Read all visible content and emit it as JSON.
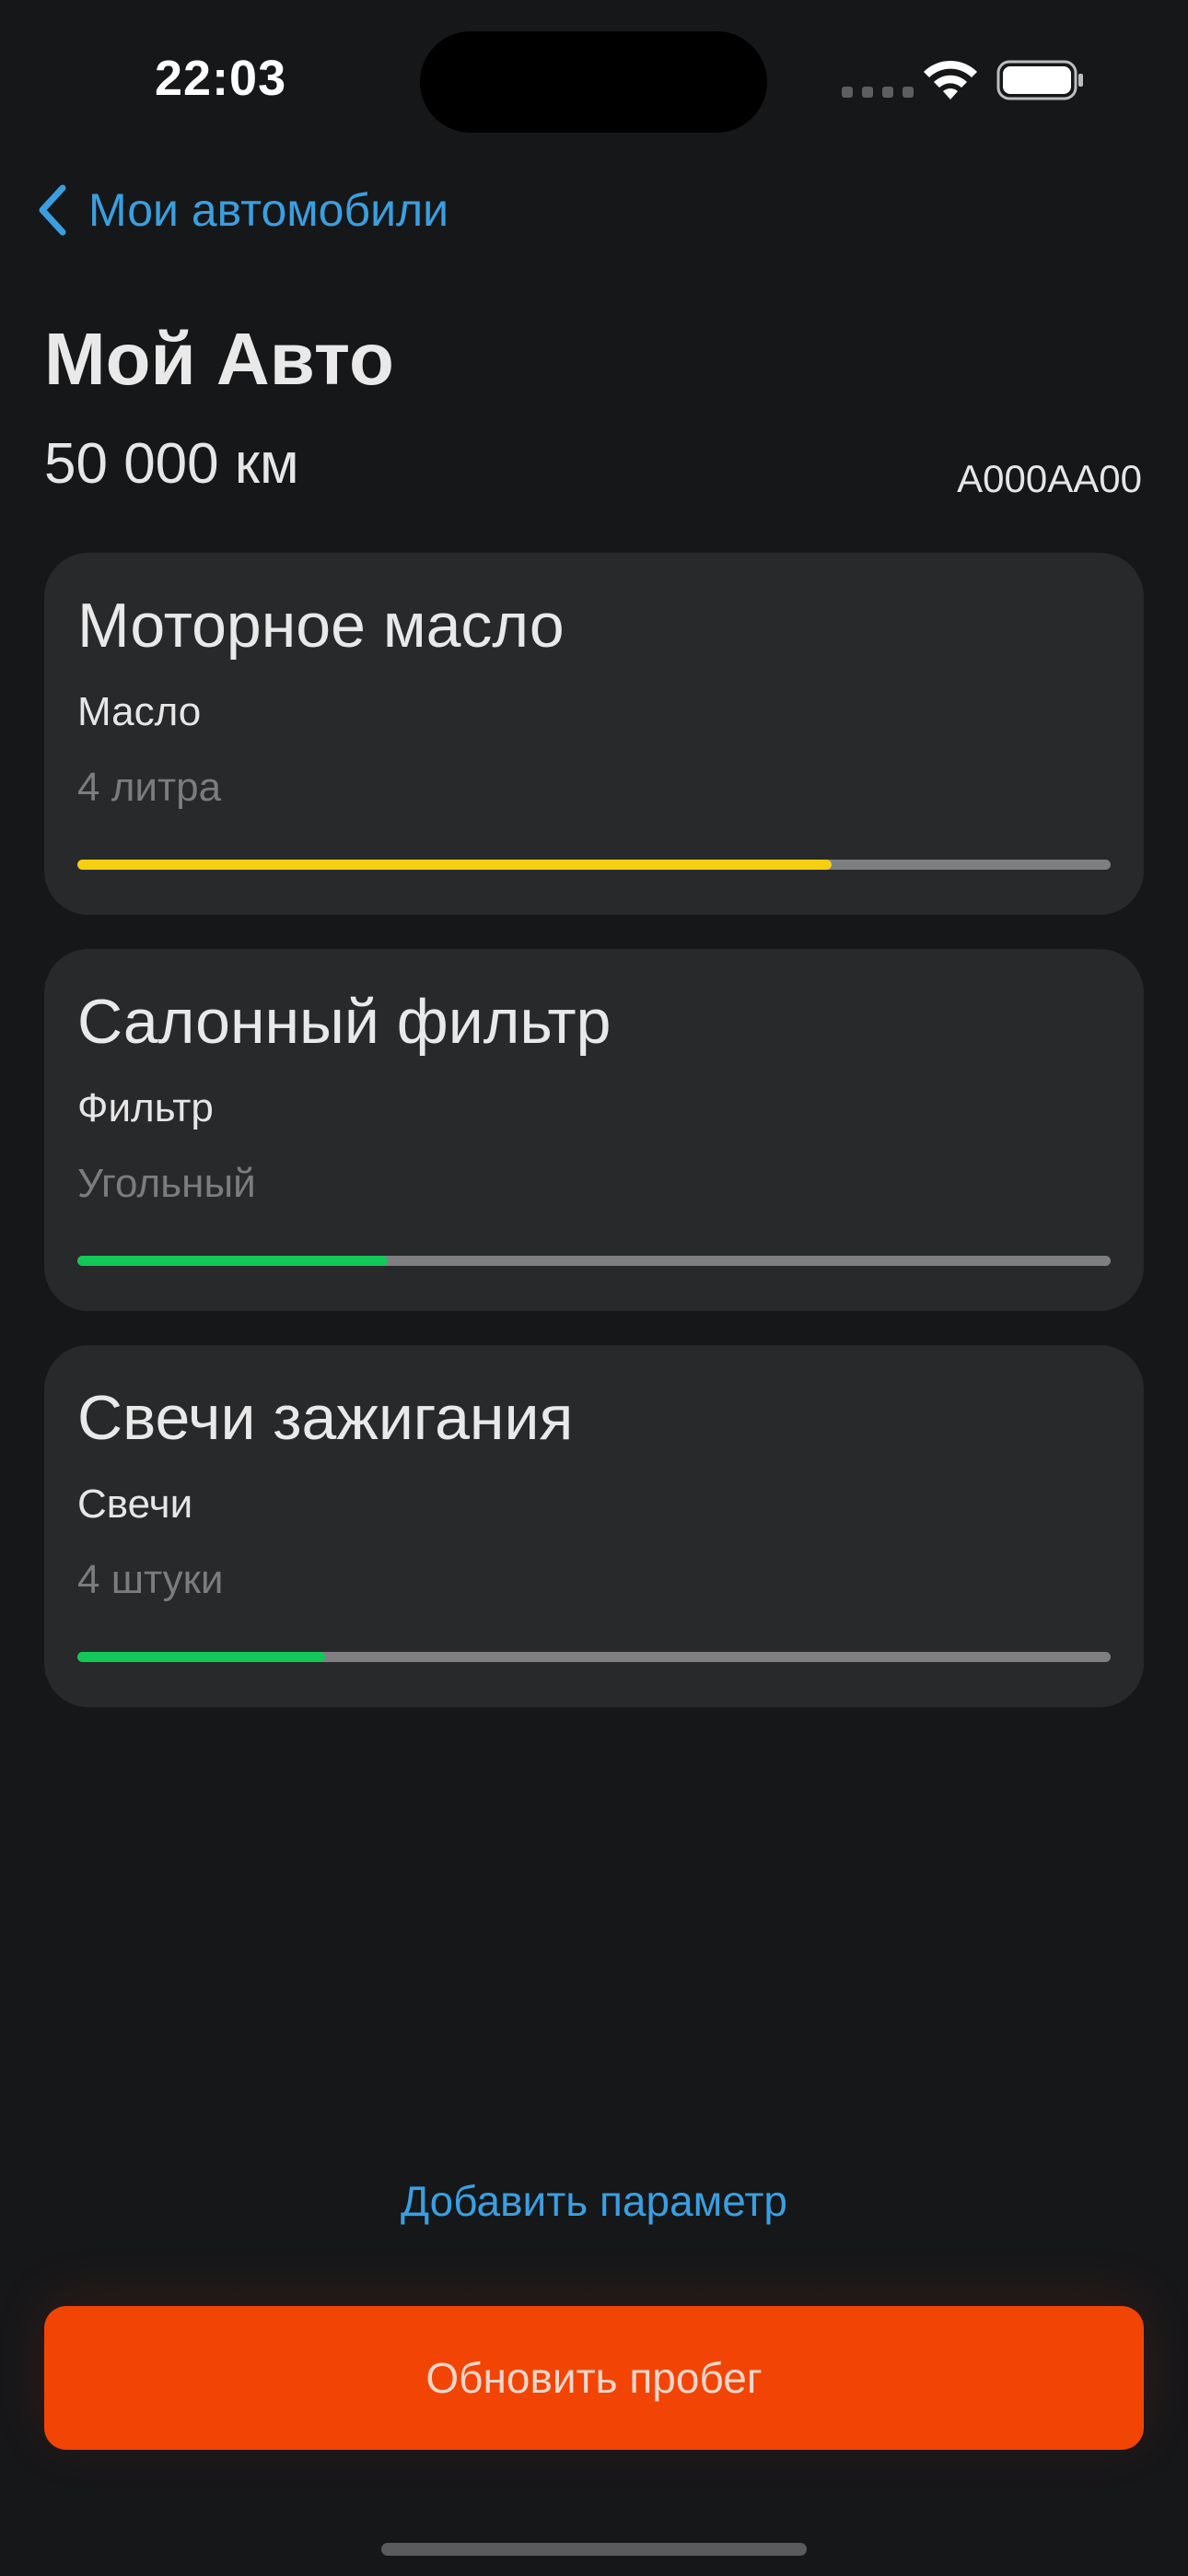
{
  "status_bar": {
    "time": "22:03"
  },
  "nav": {
    "back_label": "Мои автомобили"
  },
  "car": {
    "title": "Мой Авто",
    "mileage": "50 000 км",
    "plate": "A000AA00"
  },
  "cards": [
    {
      "title": "Моторное масло",
      "type": "Масло",
      "detail": "4 литра",
      "progress": 0.73,
      "progress_color": "#f5cf10"
    },
    {
      "title": "Салонный фильтр",
      "type": "Фильтр",
      "detail": "Угольный",
      "progress": 0.3,
      "progress_color": "#12c957"
    },
    {
      "title": "Свечи зажигания",
      "type": "Свечи",
      "detail": "4 штуки",
      "progress": 0.24,
      "progress_color": "#12c957"
    }
  ],
  "actions": {
    "add_parameter": "Добавить параметр",
    "update_mileage": "Обновить пробег"
  },
  "colors": {
    "accent_blue": "#3a9fe0",
    "primary_button": "#f24405",
    "background": "#161719",
    "card": "#28292b"
  },
  "icons": {
    "back": "chevron-left-icon",
    "wifi": "wifi-icon",
    "battery": "battery-icon"
  }
}
